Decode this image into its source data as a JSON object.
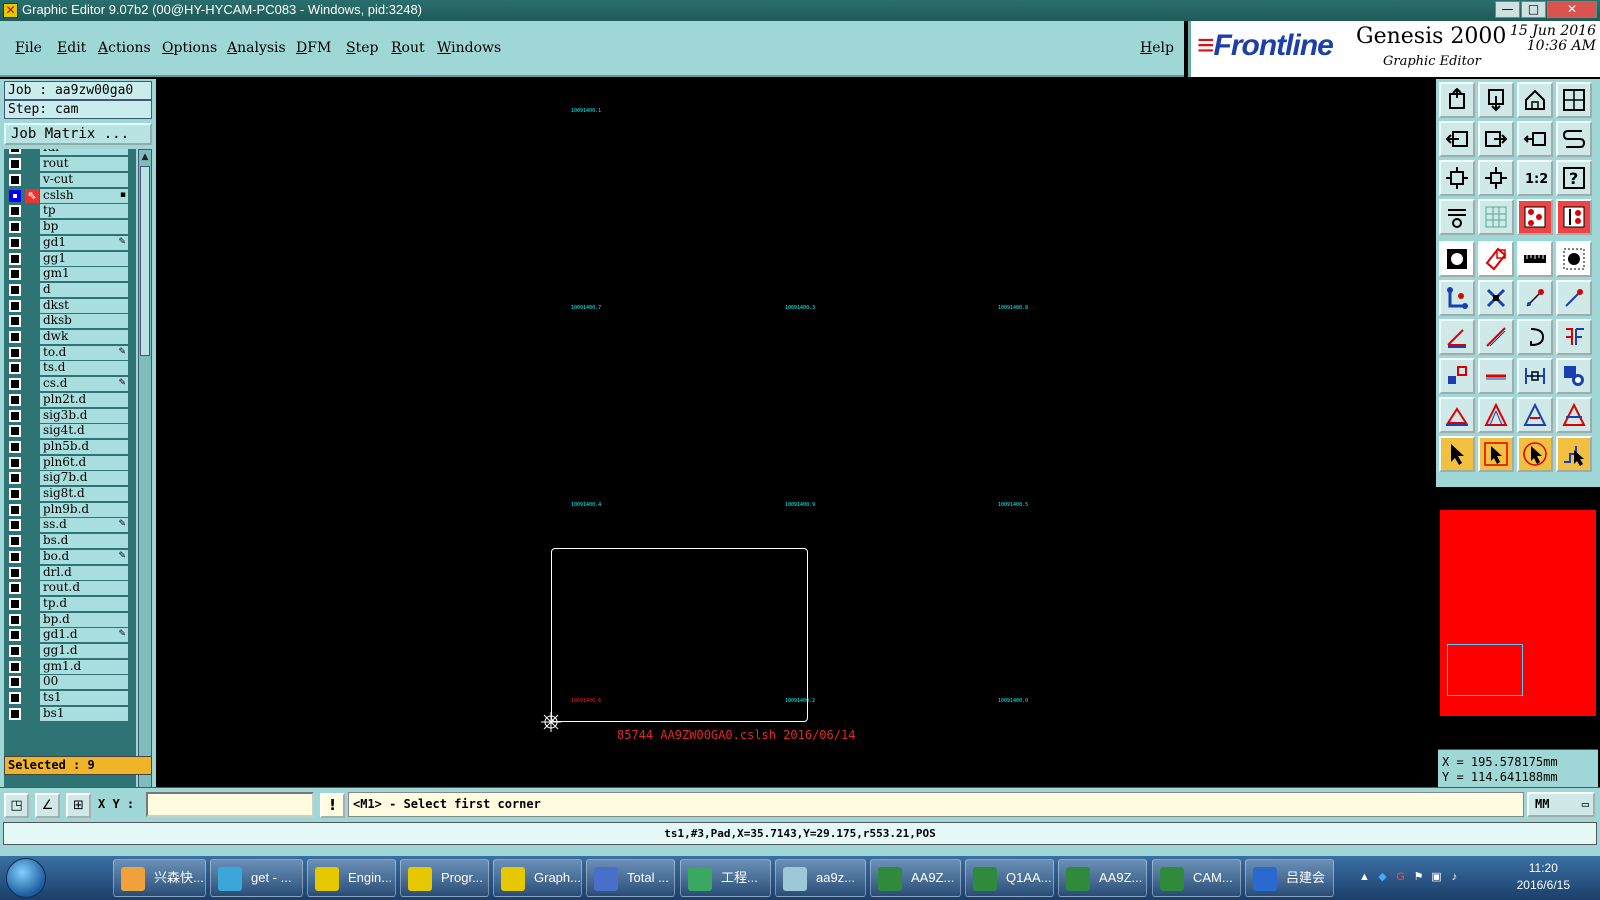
{
  "window": {
    "title": "Graphic Editor 9.07b2 (00@HY-HYCAM-PC083 - Windows, pid:3248)",
    "controls": [
      "—",
      "□",
      "✕"
    ]
  },
  "menu": {
    "items": [
      "File",
      "Edit",
      "Actions",
      "Options",
      "Analysis",
      "DFM",
      "Step",
      "Rout",
      "Windows"
    ],
    "help": "Help"
  },
  "brand": {
    "logo": "Frontline",
    "product": "Genesis 2000",
    "subtitle": "Graphic Editor",
    "date": "15 Jun 2016",
    "time": "10:36 AM"
  },
  "job": {
    "job_label": "Job : aa9zw00ga0",
    "step_label": "Step: cam",
    "matrix_button": "Job Matrix ..."
  },
  "layers": [
    {
      "name": "fdi",
      "mark": ""
    },
    {
      "name": "rout",
      "mark": ""
    },
    {
      "name": "v-cut",
      "mark": ""
    },
    {
      "name": "cslsh",
      "mark": "▪",
      "active": true
    },
    {
      "name": "tp",
      "mark": ""
    },
    {
      "name": "bp",
      "mark": ""
    },
    {
      "name": "gd1",
      "mark": "✎"
    },
    {
      "name": "gg1",
      "mark": ""
    },
    {
      "name": "gm1",
      "mark": ""
    },
    {
      "name": "d",
      "mark": ""
    },
    {
      "name": "dkst",
      "mark": ""
    },
    {
      "name": "dksb",
      "mark": ""
    },
    {
      "name": "dwk",
      "mark": ""
    },
    {
      "name": "to.d",
      "mark": "✎"
    },
    {
      "name": "ts.d",
      "mark": ""
    },
    {
      "name": "cs.d",
      "mark": "✎"
    },
    {
      "name": "pln2t.d",
      "mark": ""
    },
    {
      "name": "sig3b.d",
      "mark": ""
    },
    {
      "name": "sig4t.d",
      "mark": ""
    },
    {
      "name": "pln5b.d",
      "mark": ""
    },
    {
      "name": "pln6t.d",
      "mark": ""
    },
    {
      "name": "sig7b.d",
      "mark": ""
    },
    {
      "name": "sig8t.d",
      "mark": ""
    },
    {
      "name": "pln9b.d",
      "mark": ""
    },
    {
      "name": "ss.d",
      "mark": "✎"
    },
    {
      "name": "bs.d",
      "mark": ""
    },
    {
      "name": "bo.d",
      "mark": "✎"
    },
    {
      "name": "drl.d",
      "mark": ""
    },
    {
      "name": "rout.d",
      "mark": ""
    },
    {
      "name": "tp.d",
      "mark": ""
    },
    {
      "name": "bp.d",
      "mark": ""
    },
    {
      "name": "gd1.d",
      "mark": "✎"
    },
    {
      "name": "gg1.d",
      "mark": ""
    },
    {
      "name": "gm1.d",
      "mark": ""
    },
    {
      "name": "00",
      "mark": ""
    },
    {
      "name": "ts1",
      "mark": ""
    },
    {
      "name": "bs1",
      "mark": ""
    }
  ],
  "selected": "Selected : 9",
  "canvas": {
    "labels": [
      {
        "text": "10091400.1",
        "color": "cyan"
      },
      {
        "text": "10091400.7",
        "color": "cyan"
      },
      {
        "text": "10091400.3",
        "color": "cyan"
      },
      {
        "text": "10091400.8",
        "color": "cyan"
      },
      {
        "text": "10091400.4",
        "color": "cyan"
      },
      {
        "text": "10091400.9",
        "color": "cyan"
      },
      {
        "text": "10091400.5",
        "color": "cyan"
      },
      {
        "text": "10091400.6",
        "color": "red"
      },
      {
        "text": "10091400.2",
        "color": "cyan"
      },
      {
        "text": "10091400.0",
        "color": "cyan"
      }
    ],
    "caption": "85744 AA9ZW00GA0.cslsh 2016/06/14"
  },
  "coords": {
    "x": "X = 195.578175mm",
    "y": "Y = 114.641188mm"
  },
  "command": {
    "xy_label": "X Y :",
    "xy_value": "",
    "prompt": "<M1> - Select first corner",
    "units": "MM"
  },
  "info": "ts1,#3,Pad,X=35.7143,Y=29.175,r553.21,POS",
  "taskbar": {
    "tasks": [
      {
        "label": "兴森快...",
        "color": "#f2a23a"
      },
      {
        "label": "get - ...",
        "color": "#3da6d8"
      },
      {
        "label": "Engin...",
        "color": "#e6c800"
      },
      {
        "label": "Progr...",
        "color": "#e6c800"
      },
      {
        "label": "Graph...",
        "color": "#e6c800"
      },
      {
        "label": "Total ...",
        "color": "#4a6fc8"
      },
      {
        "label": "工程...",
        "color": "#3aa860"
      },
      {
        "label": "aa9z...",
        "color": "#9cc8d8"
      },
      {
        "label": "AA9Z...",
        "color": "#2f8a3c"
      },
      {
        "label": "Q1AA...",
        "color": "#2f8a3c"
      },
      {
        "label": "AA9Z...",
        "color": "#2f8a3c"
      },
      {
        "label": "CAM...",
        "color": "#2f8a3c"
      },
      {
        "label": "吕建会",
        "color": "#2a6ad0"
      }
    ],
    "time": "11:20",
    "date": "2016/6/15"
  }
}
